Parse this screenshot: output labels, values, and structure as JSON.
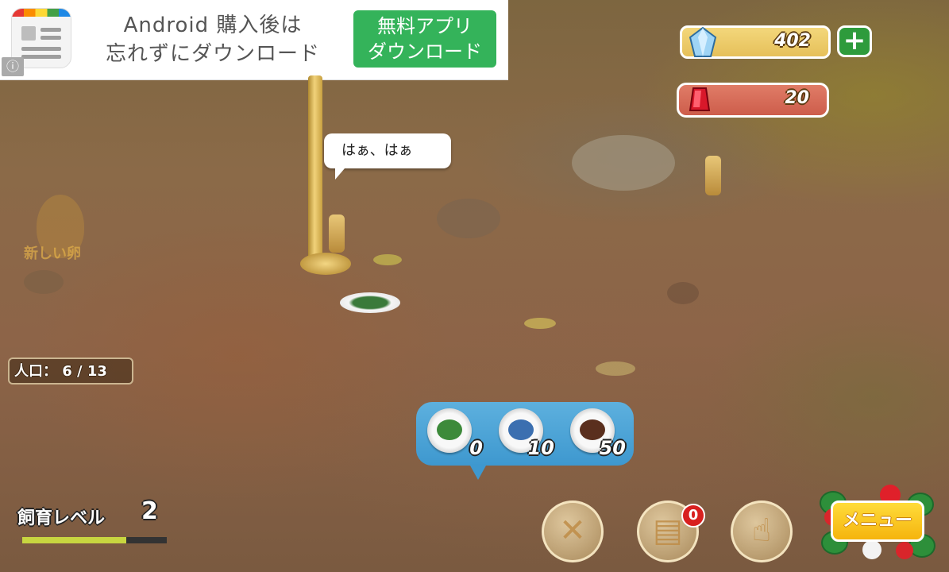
{
  "ad": {
    "text_line1": "Android 購入後は",
    "text_line2": "忘れずにダウンロード",
    "button_line1": "無料アプリ",
    "button_line2": "ダウンロード",
    "info_icon": "info-icon"
  },
  "currency": {
    "gems": "402",
    "rubies": "20",
    "gem_icon": "diamond-icon",
    "ruby_icon": "ruby-icon",
    "plus_label": "+"
  },
  "speech_bubble": {
    "text": "はぁ、はぁ"
  },
  "new_egg": {
    "label": "新しい卵"
  },
  "population": {
    "text": "人口： 6 / 13"
  },
  "food_menu": {
    "items": [
      {
        "name": "vegetables",
        "cost": "0",
        "color": "#3d8a3a"
      },
      {
        "name": "fish",
        "cost": "10",
        "color": "#3b6fb0"
      },
      {
        "name": "steak",
        "cost": "50",
        "color": "#5a2f1e"
      }
    ]
  },
  "breeding": {
    "label": "飼育レベル",
    "level": "2",
    "progress": 0.72
  },
  "toolbar": {
    "feed_icon": "fork-knife-icon",
    "tasks_icon": "clipboard-icon",
    "tasks_badge": "0",
    "tap_icon": "hand-pointer-icon",
    "menu_label": "メニュー"
  },
  "colors": {
    "gem_bar": "#e6c05a",
    "ruby_bar": "#cd5d4b",
    "food_panel": "#3e98cf",
    "menu_button": "#f5b40e",
    "badge": "#d8201f"
  }
}
